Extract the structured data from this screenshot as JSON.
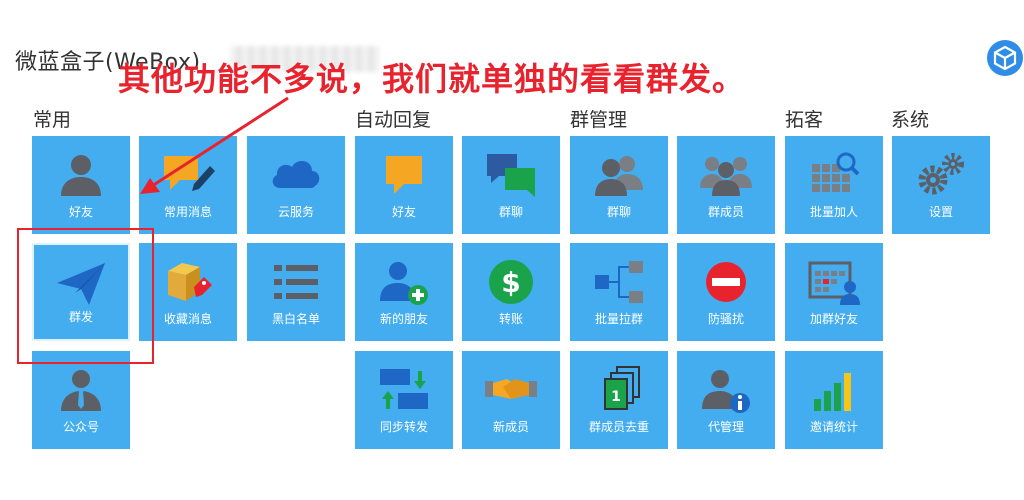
{
  "app": {
    "title": "微蓝盒子(WeBox)"
  },
  "annotation": {
    "text": "其他功能不多说，我们就单独的看看群发。"
  },
  "sections": {
    "common": "常用",
    "auto_reply": "自动回复",
    "group_mgmt": "群管理",
    "expand": "拓客",
    "system": "系统"
  },
  "tiles": {
    "friends": "好友",
    "common_messages": "常用消息",
    "cloud_service": "云服务",
    "mass_send": "群发",
    "favorites": "收藏消息",
    "blackwhite_list": "黑白名单",
    "official_accounts": "公众号",
    "auto_friends": "好友",
    "auto_group_chat": "群聊",
    "new_friends": "新的朋友",
    "transfer": "转账",
    "sync_forward": "同步转发",
    "new_members": "新成员",
    "grp_group_chat": "群聊",
    "group_members": "群成员",
    "batch_pull_group": "批量拉群",
    "anti_harass": "防骚扰",
    "dedupe_members": "群成员去重",
    "proxy_manage": "代管理",
    "batch_add": "批量加人",
    "add_group_friends": "加群好友",
    "invite_stats": "邀请统计",
    "settings": "设置"
  },
  "colors": {
    "tile_bg": "#43adf0",
    "annotation_red": "#e8232d",
    "icon_gray": "#5c6066",
    "icon_orange": "#f5a623",
    "icon_green": "#1aa34a"
  }
}
